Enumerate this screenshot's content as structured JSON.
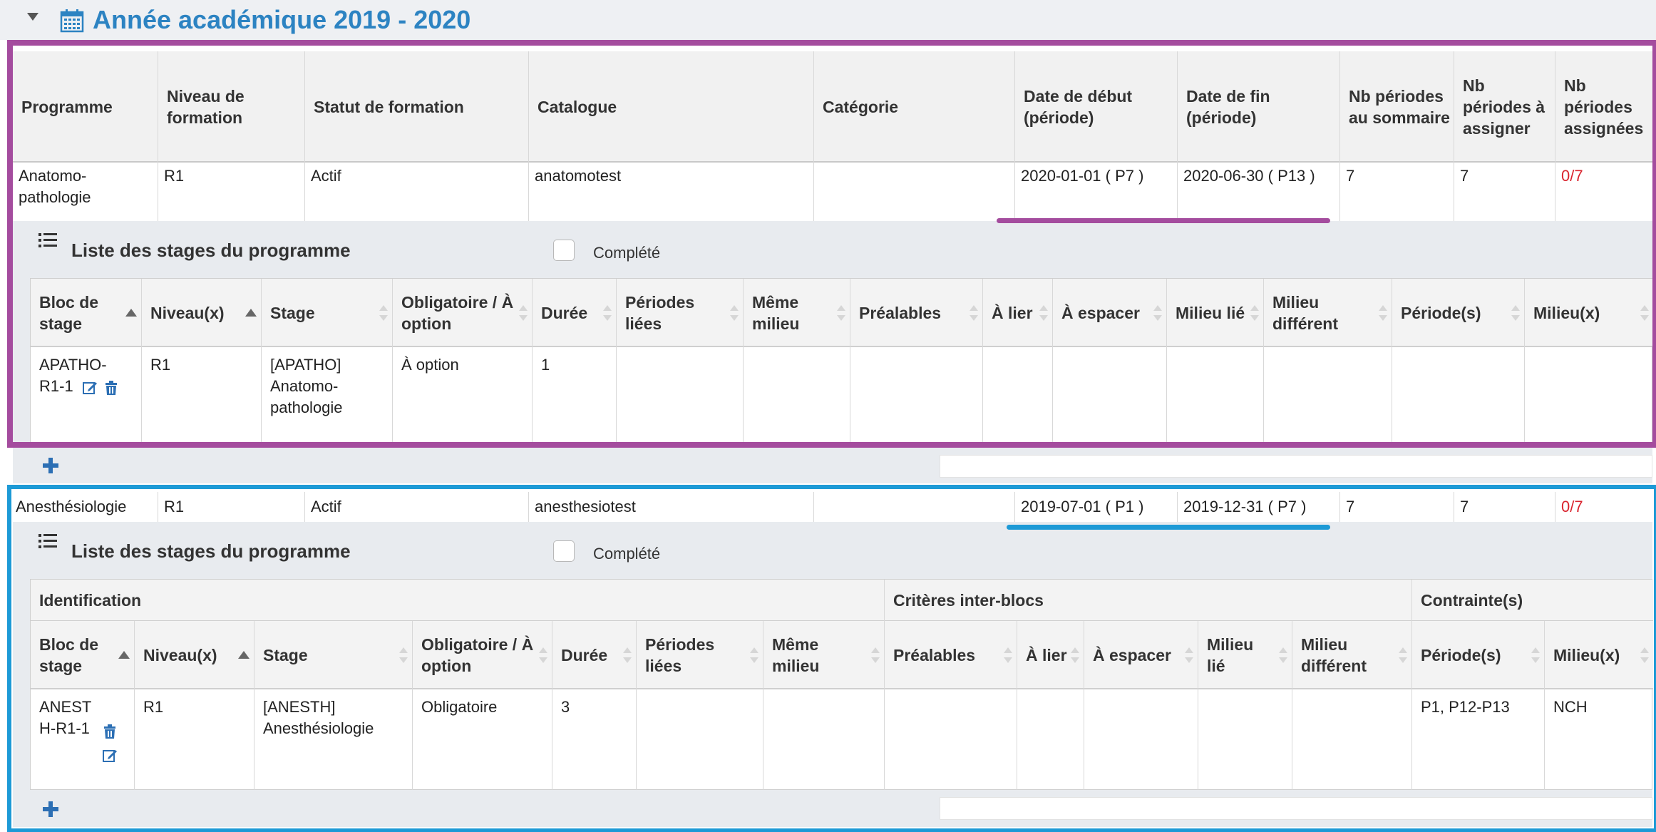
{
  "academic_year": {
    "title": "Année académique 2019 - 2020"
  },
  "program_table": {
    "headers": {
      "programme": "Programme",
      "niveau": "Niveau de formation",
      "statut": "Statut de formation",
      "catalogue": "Catalogue",
      "categorie": "Catégorie",
      "date_debut": "Date de début (période)",
      "date_fin": "Date de fin (période)",
      "nb_sommaire": "Nb périodes au sommaire",
      "nb_assigner": "Nb périodes à assigner",
      "nb_assignees": "Nb périodes assignées"
    },
    "rows": [
      {
        "programme": "Anatomo-pathologie",
        "niveau": "R1",
        "statut": "Actif",
        "catalogue": "anatomotest",
        "categorie": "",
        "date_debut": "2020-01-01 ( P7 )",
        "date_fin": "2020-06-30 ( P13 )",
        "nb_sommaire": "7",
        "nb_assigner": "7",
        "nb_assignees": "0/7"
      },
      {
        "programme": "Anesthésiologie",
        "niveau": "R1",
        "statut": "Actif",
        "catalogue": "anesthesiotest",
        "categorie": "",
        "date_debut": "2019-07-01 ( P1 )",
        "date_fin": "2019-12-31 ( P7 )",
        "nb_sommaire": "7",
        "nb_assigner": "7",
        "nb_assignees": "0/7"
      }
    ]
  },
  "stages_panel": {
    "title": "Liste des stages du programme",
    "completed_label": "Complété",
    "group_headers": {
      "identification": "Identification",
      "criteres": "Critères inter-blocs",
      "contraintes": "Contrainte(s)"
    },
    "columns": {
      "bloc": "Bloc de stage",
      "niveau": "Niveau(x)",
      "stage": "Stage",
      "obligatoire": "Obligatoire / À option",
      "duree": "Durée",
      "periodes_liees": "Périodes liées",
      "meme_milieu": "Même milieu",
      "prealables": "Préalables",
      "a_lier": "À lier",
      "a_espacer": "À espacer",
      "milieu_lie": "Milieu lié",
      "milieu_different": "Milieu différent",
      "periodes": "Période(s)",
      "milieux": "Milieu(x)"
    },
    "anatomo_rows": [
      {
        "bloc": "APATHO-R1-1",
        "niveau": "R1",
        "stage": "[APATHO] Anatomo-pathologie",
        "obligatoire": "À option",
        "duree": "1",
        "periodes": "",
        "milieux": ""
      }
    ],
    "anesth_rows": [
      {
        "bloc": "ANESTH-R1-1",
        "niveau": "R1",
        "stage": "[ANESTH] Anesthésiologie",
        "obligatoire": "Obligatoire",
        "duree": "3",
        "periodes": "P1, P12-P13",
        "milieux": "NCH"
      }
    ]
  },
  "colors": {
    "title_blue": "#2c83c2",
    "frame_purple": "#a44c9e",
    "frame_blue": "#1d9ad6",
    "alert_red": "#d9232d",
    "icon_blue": "#2c6fb4"
  },
  "icons": [
    "chevron-down-icon",
    "calendar-icon",
    "list-icon",
    "edit-icon",
    "trash-icon",
    "plus-icon",
    "sort-icon"
  ]
}
